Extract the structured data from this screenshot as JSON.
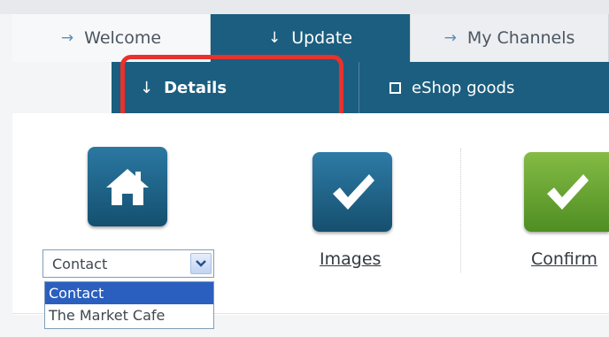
{
  "main_tabs": {
    "welcome": "Welcome",
    "update": "Update",
    "my_channels": "My Channels"
  },
  "sub_tabs": {
    "details": "Details",
    "eshop_goods": "eShop goods"
  },
  "steps": {
    "images_link": "Images",
    "confirm_link": "Confirm"
  },
  "dropdown": {
    "selected": "Contact",
    "options": [
      "Contact",
      "The Market Cafe"
    ]
  },
  "icons": {
    "home_tile": "home-icon",
    "images_tile": "checkmark-icon",
    "confirm_tile": "checkmark-icon",
    "dropdown_arrow": "chevron-down-icon"
  },
  "colors": {
    "nav_active": "#1b5e7f",
    "highlight": "#e8322b",
    "confirm_green": "#6aa834",
    "selected_option": "#2a5fbf"
  }
}
